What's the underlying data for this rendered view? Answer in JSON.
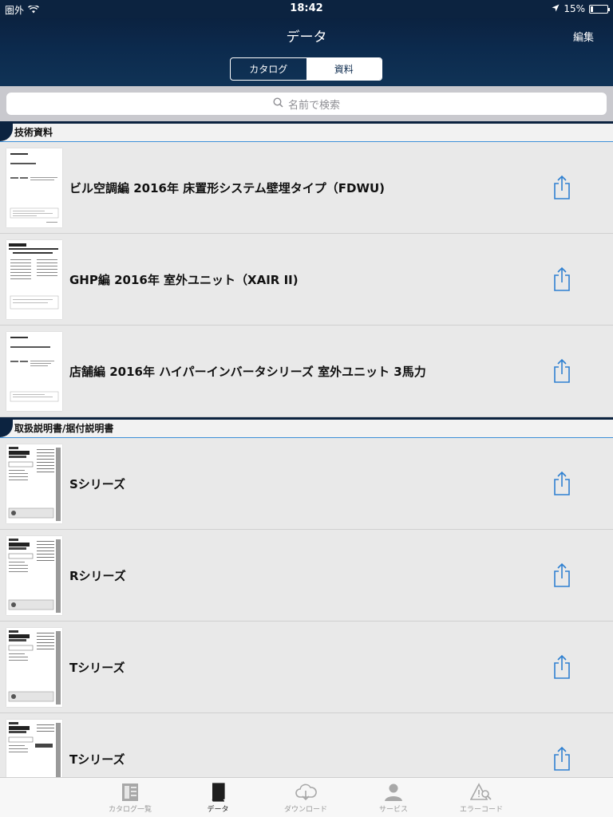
{
  "status_bar": {
    "carrier": "圏外",
    "time": "18:42",
    "battery_text": "15%",
    "battery_level": 0.15
  },
  "header": {
    "title": "データ",
    "edit_label": "編集"
  },
  "segmented": {
    "catalog_label": "カタログ",
    "document_label": "資料"
  },
  "search": {
    "placeholder": "名前で検索"
  },
  "sections": [
    {
      "title": "技術資料",
      "items": [
        {
          "title": "ビル空調編 2016年 床置形システム壁埋タイプ（FDWU)"
        },
        {
          "title": "GHP編 2016年 室外ユニット（XAIR II)"
        },
        {
          "title": "店舗編 2016年 ハイパーインバータシリーズ 室外ユニット 3馬力"
        }
      ]
    },
    {
      "title": "取扱説明書/据付説明書",
      "items": [
        {
          "title": "Sシリーズ"
        },
        {
          "title": "Rシリーズ"
        },
        {
          "title": "Tシリーズ"
        },
        {
          "title": "Tシリーズ"
        }
      ]
    }
  ],
  "tabs": [
    {
      "label": "カタログ一覧",
      "icon": "catalog-list-icon"
    },
    {
      "label": "データ",
      "icon": "data-book-icon"
    },
    {
      "label": "ダウンロード",
      "icon": "cloud-download-icon"
    },
    {
      "label": "サービス",
      "icon": "person-icon"
    },
    {
      "label": "エラーコード",
      "icon": "warning-search-icon"
    }
  ],
  "colors": {
    "nav_bg": "#0c2a4d",
    "accent_blue": "#3d8fd8",
    "share_blue": "#2f80d1"
  }
}
